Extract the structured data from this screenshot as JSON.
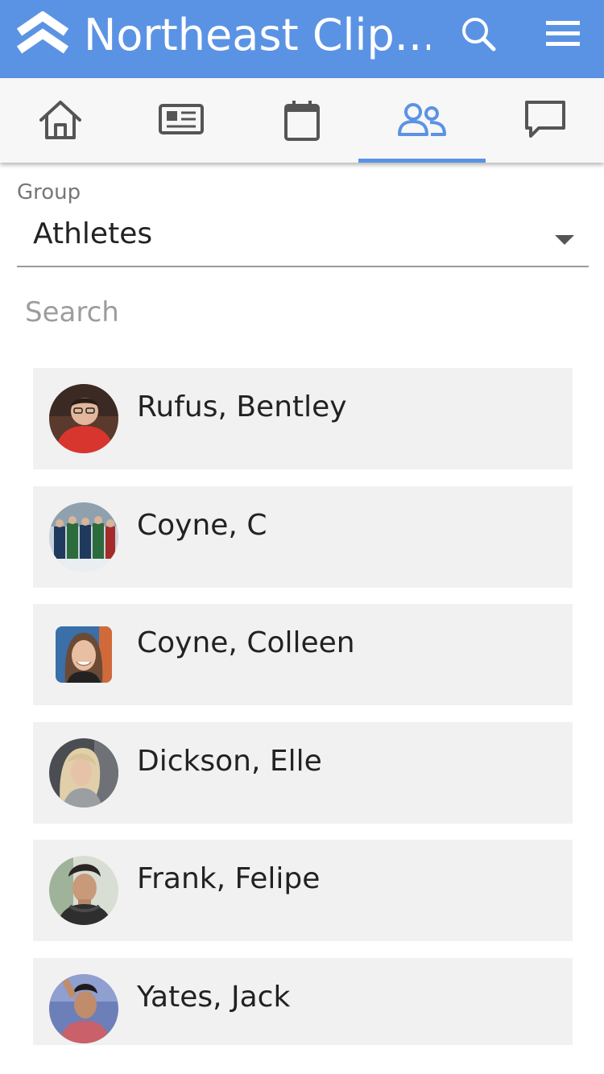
{
  "app": {
    "title": "Northeast Clip..."
  },
  "header": {
    "search_icon": "search-icon",
    "menu_icon": "hamburger-menu-icon",
    "logo_icon": "double-chevron-logo-icon"
  },
  "tabs": [
    {
      "name": "home",
      "icon": "home-icon",
      "active": false
    },
    {
      "name": "news",
      "icon": "newspaper-icon",
      "active": false
    },
    {
      "name": "calendar",
      "icon": "calendar-icon",
      "active": false
    },
    {
      "name": "people",
      "icon": "people-icon",
      "active": true
    },
    {
      "name": "messages",
      "icon": "chat-bubble-icon",
      "active": false
    }
  ],
  "filter": {
    "group_label": "Group",
    "group_value": "Athletes",
    "search_placeholder": "Search"
  },
  "people": [
    {
      "name": "Rufus, Bentley"
    },
    {
      "name": "Coyne, C"
    },
    {
      "name": "Coyne, Colleen"
    },
    {
      "name": "Dickson, Elle"
    },
    {
      "name": "Frank, Felipe"
    },
    {
      "name": "Yates, Jack"
    }
  ],
  "colors": {
    "accent": "#5b93e4",
    "tab_bar": "#f7f7f7",
    "list_item_bg": "#f1f1f1",
    "icon_gray": "#555555"
  }
}
